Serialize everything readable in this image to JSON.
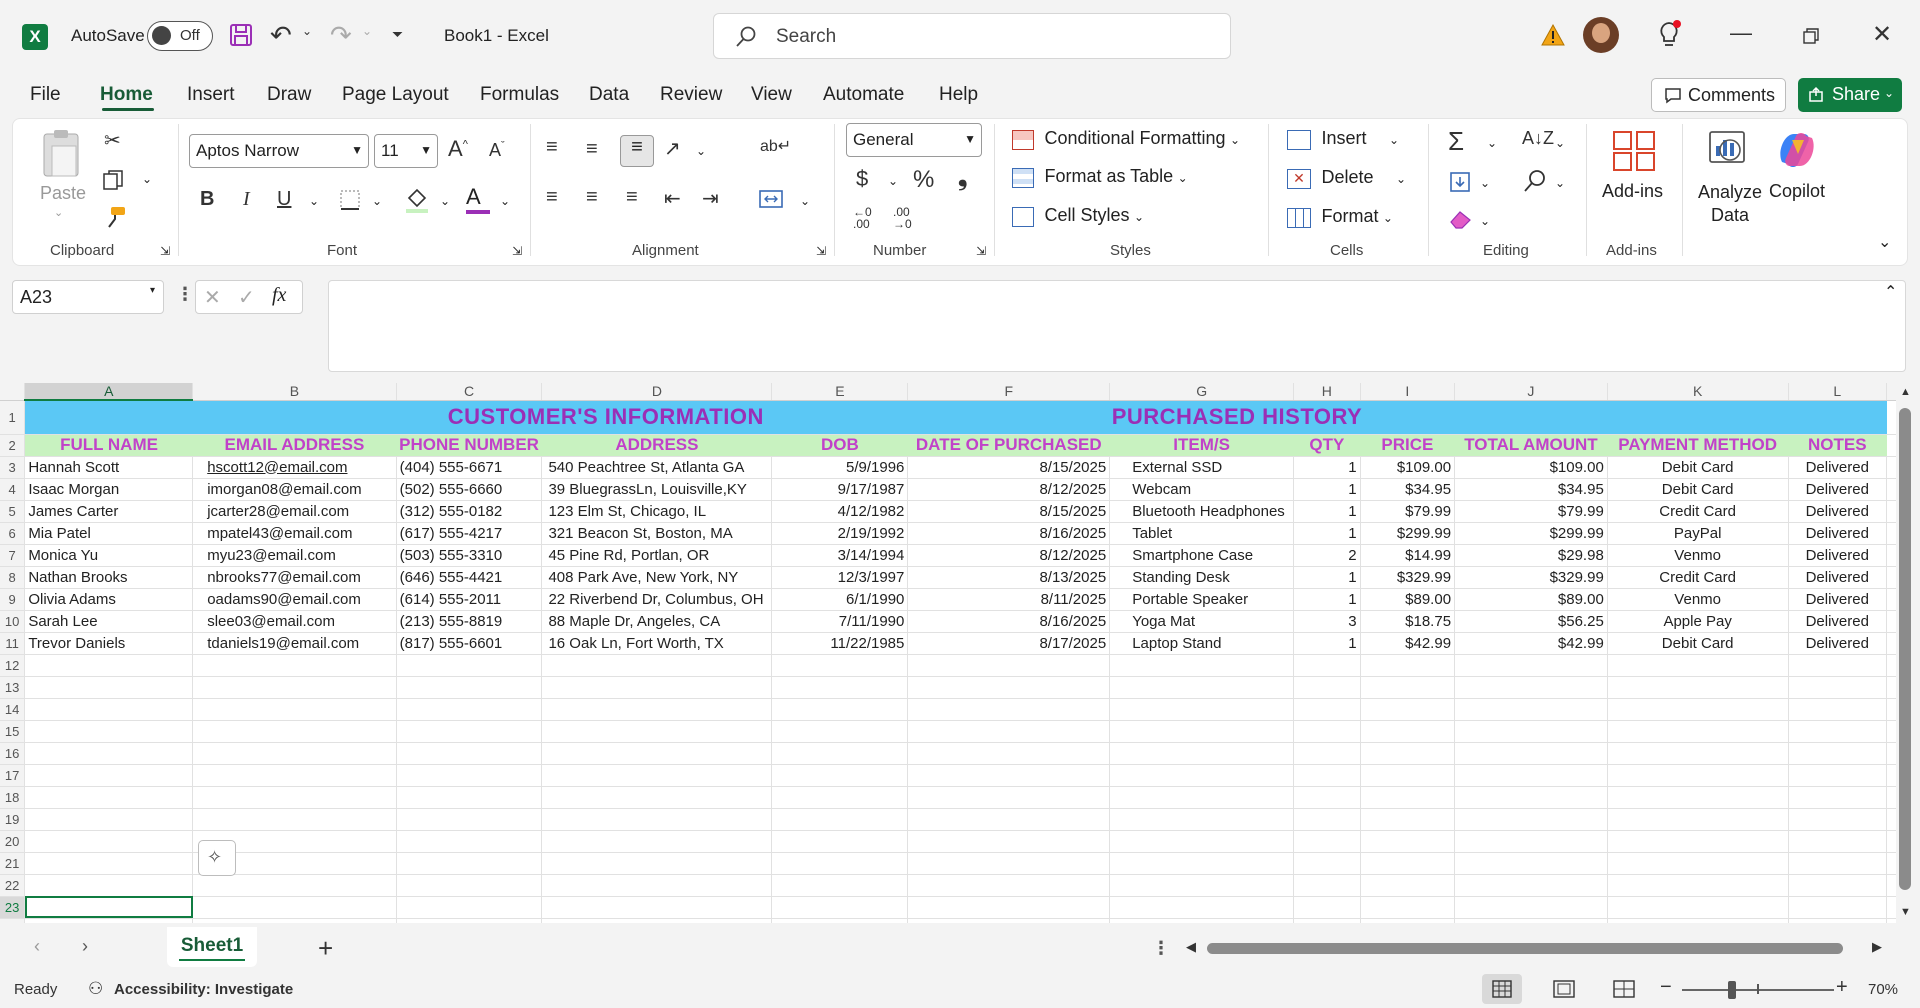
{
  "titlebar": {
    "app_icon": "X",
    "autosave_label": "AutoSave",
    "autosave_state": "Off",
    "doc_title": "Book1  -  Excel",
    "search_placeholder": "Search"
  },
  "menu": {
    "items": [
      "File",
      "Home",
      "Insert",
      "Draw",
      "Page Layout",
      "Formulas",
      "Data",
      "Review",
      "View",
      "Automate",
      "Help"
    ],
    "active": "Home",
    "comments_label": "Comments",
    "share_label": "Share"
  },
  "ribbon": {
    "clipboard": {
      "paste": "Paste",
      "label": "Clipboard"
    },
    "font": {
      "family": "Aptos Narrow",
      "size": "11",
      "label": "Font"
    },
    "alignment": {
      "label": "Alignment"
    },
    "number": {
      "format": "General",
      "label": "Number"
    },
    "styles": {
      "conditional": "Conditional Formatting",
      "table": "Format as Table",
      "cellstyles": "Cell Styles",
      "label": "Styles"
    },
    "cells": {
      "insert": "Insert",
      "delete": "Delete",
      "format": "Format",
      "label": "Cells"
    },
    "editing": {
      "label": "Editing"
    },
    "addins": {
      "addins": "Add-ins",
      "label": "Add-ins"
    },
    "analyze": {
      "line1": "Analyze",
      "line2": "Data"
    },
    "copilot": "Copilot"
  },
  "formula_bar": {
    "name_box": "A23",
    "fx": "fx",
    "value": ""
  },
  "sheet": {
    "columns": [
      "A",
      "B",
      "C",
      "D",
      "E",
      "F",
      "G",
      "H",
      "I",
      "J",
      "K",
      "L"
    ],
    "section_left": "CUSTOMER'S INFORMATION",
    "section_right": "PURCHASED HISTORY",
    "headers": [
      "FULL NAME",
      "EMAIL ADDRESS",
      "PHONE NUMBER",
      "ADDRESS",
      "DOB",
      "DATE OF PURCHASED",
      "ITEM/S",
      "QTY",
      "PRICE",
      "TOTAL AMOUNT",
      "PAYMENT METHOD",
      "NOTES"
    ],
    "rows": [
      [
        "Hannah Scott",
        "hscott12@email.com",
        "(404) 555-6671",
        "540 Peachtree St, Atlanta GA",
        "5/9/1996",
        "8/15/2025",
        "External SSD",
        "1",
        "$109.00",
        "$109.00",
        "Debit Card",
        "Delivered"
      ],
      [
        "Isaac Morgan",
        "imorgan08@email.com",
        "(502) 555-6660",
        "39 BluegrassLn, Louisville,KY",
        "9/17/1987",
        "8/12/2025",
        "Webcam",
        "1",
        "$34.95",
        "$34.95",
        "Debit Card",
        "Delivered"
      ],
      [
        "James Carter",
        "jcarter28@email.com",
        "(312) 555-0182",
        "123 Elm St, Chicago, IL",
        "4/12/1982",
        "8/15/2025",
        "Bluetooth Headphones",
        "1",
        "$79.99",
        "$79.99",
        "Credit Card",
        "Delivered"
      ],
      [
        "Mia Patel",
        "mpatel43@email.com",
        "(617) 555-4217",
        "321 Beacon St, Boston, MA",
        "2/19/1992",
        "8/16/2025",
        "Tablet",
        "1",
        "$299.99",
        "$299.99",
        "PayPal",
        "Delivered"
      ],
      [
        "Monica Yu",
        "myu23@email.com",
        "(503) 555-3310",
        "45 Pine Rd, Portlan, OR",
        "3/14/1994",
        "8/12/2025",
        "Smartphone Case",
        "2",
        "$14.99",
        "$29.98",
        "Venmo",
        "Delivered"
      ],
      [
        "Nathan Brooks",
        "nbrooks77@email.com",
        "(646) 555-4421",
        "408 Park Ave, New York, NY",
        "12/3/1997",
        "8/13/2025",
        "Standing Desk",
        "1",
        "$329.99",
        "$329.99",
        "Credit Card",
        "Delivered"
      ],
      [
        "Olivia Adams",
        "oadams90@email.com",
        "(614) 555-2011",
        "22 Riverbend Dr, Columbus, OH",
        "6/1/1990",
        "8/11/2025",
        "Portable Speaker",
        "1",
        "$89.00",
        "$89.00",
        "Venmo",
        "Delivered"
      ],
      [
        "Sarah Lee",
        "slee03@email.com",
        "(213) 555-8819",
        "88 Maple Dr, Angeles, CA",
        "7/11/1990",
        "8/16/2025",
        "Yoga Mat",
        "3",
        "$18.75",
        "$56.25",
        "Apple Pay",
        "Delivered"
      ],
      [
        "Trevor Daniels",
        "tdaniels19@email.com",
        "(817) 555-6601",
        "16 Oak Ln, Fort Worth, TX",
        "11/22/1985",
        "8/17/2025",
        "Laptop Stand",
        "1",
        "$42.99",
        "$42.99",
        "Debit Card",
        "Delivered"
      ]
    ],
    "row_numbers": [
      "1",
      "2",
      "3",
      "4",
      "5",
      "6",
      "7",
      "8",
      "9",
      "10",
      "11",
      "12",
      "13",
      "14",
      "15",
      "16",
      "17",
      "18",
      "19",
      "20",
      "21",
      "22",
      "23",
      "24"
    ],
    "selected_cell": "A23"
  },
  "tabs": {
    "sheet1": "Sheet1"
  },
  "status": {
    "ready": "Ready",
    "accessibility": "Accessibility: Investigate",
    "zoom": "70%"
  },
  "colors": {
    "accent": "#107c41",
    "title_band": "#5bc8f5",
    "header_band": "#c8f2c0",
    "header_text": "#c142c9",
    "section_text": "#9b2fb6"
  }
}
